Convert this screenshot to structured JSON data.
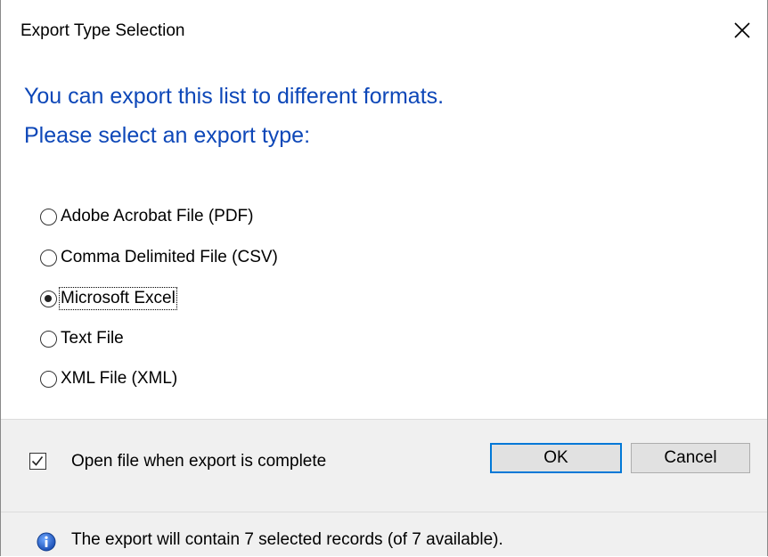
{
  "window": {
    "title": "Export Type Selection"
  },
  "heading": {
    "line1": "You can export this list to different formats.",
    "line2": "Please select an export type:"
  },
  "export_types": [
    {
      "label": "Adobe Acrobat File (PDF)",
      "selected": false
    },
    {
      "label": "Comma Delimited File (CSV)",
      "selected": false
    },
    {
      "label": "Microsoft Excel",
      "selected": true
    },
    {
      "label": "Text File",
      "selected": false
    },
    {
      "label": "XML File (XML)",
      "selected": false
    }
  ],
  "options": {
    "open_file_label": "Open file when export is complete",
    "open_file_checked": true
  },
  "buttons": {
    "ok": "OK",
    "cancel": "Cancel"
  },
  "status": {
    "message": "The export will contain 7 selected records (of 7 available).",
    "icon": "info-icon"
  },
  "colors": {
    "heading": "#0d47b8",
    "accent": "#0078d7",
    "footer_bg": "#f0f0f0"
  }
}
